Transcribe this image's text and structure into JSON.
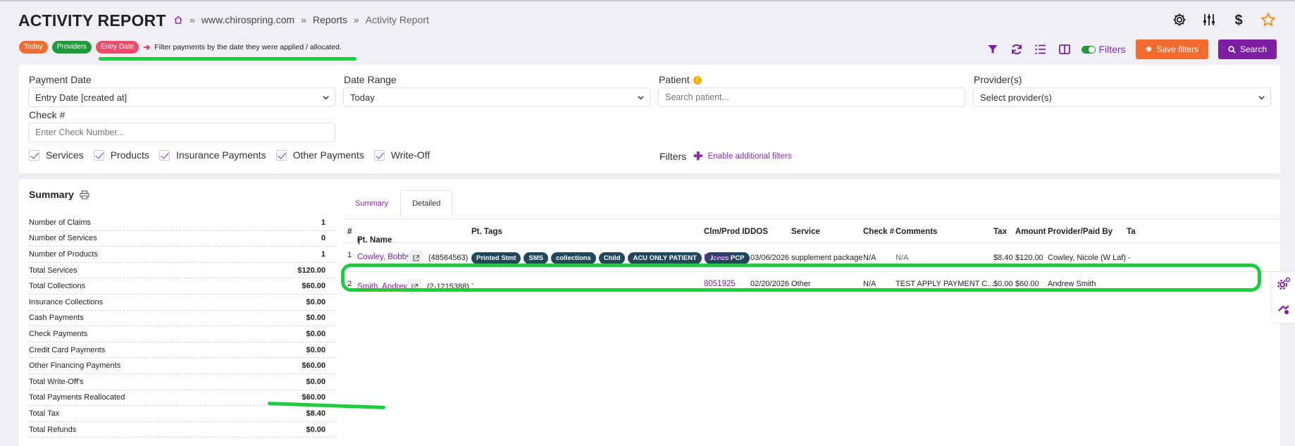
{
  "header": {
    "title": "ACTIVITY REPORT",
    "breadcrumb": [
      "www.chirospring.com",
      "Reports",
      "Activity Report"
    ],
    "separator": "»"
  },
  "badges": {
    "today": "Today",
    "providers": "Providers",
    "entry_date": "Entry Date",
    "description": "Filter payments by the date they were applied / allocated."
  },
  "toolbar": {
    "filters_label": "Filters",
    "save_filters": "Save filters",
    "search": "Search"
  },
  "filters": {
    "payment_date_label": "Payment Date",
    "payment_date_value": "Entry Date [created at]",
    "date_range_label": "Date Range",
    "date_range_value": "Today",
    "patient_label": "Patient",
    "patient_placeholder": "Search patient...",
    "providers_label": "Provider(s)",
    "providers_placeholder": "Select provider(s)",
    "check_label": "Check #",
    "check_placeholder": "Enter Check Number...",
    "checkboxes": [
      "Services",
      "Products",
      "Insurance Payments",
      "Other Payments",
      "Write-Off"
    ],
    "filters_label": "Filters",
    "enable_additional": "Enable additional filters"
  },
  "summary": {
    "title": "Summary",
    "rows": [
      {
        "label": "Number of Claims",
        "value": "1"
      },
      {
        "label": "Number of Services",
        "value": "0"
      },
      {
        "label": "Number of Products",
        "value": "1"
      },
      {
        "label": "Total Services",
        "value": "$120.00"
      },
      {
        "label": "Total Collections",
        "value": "$60.00"
      },
      {
        "label": "Insurance Collections",
        "value": "$0.00"
      },
      {
        "label": "Cash Payments",
        "value": "$0.00"
      },
      {
        "label": "Check Payments",
        "value": "$0.00"
      },
      {
        "label": "Credit Card Payments",
        "value": "$0.00"
      },
      {
        "label": "Other Financing Payments",
        "value": "$60.00"
      },
      {
        "label": "Total Write-Off's",
        "value": "$0.00"
      },
      {
        "label": "Total Payments Reallocated",
        "value": "$60.00"
      },
      {
        "label": "Total Tax",
        "value": "$8.40"
      },
      {
        "label": "Total Refunds",
        "value": "$0.00"
      }
    ]
  },
  "tabs": [
    "Summary",
    "Detailed"
  ],
  "table": {
    "headers": [
      "#",
      "Pt. Name",
      "Pt. Tags",
      "Clm/Prod ID",
      "DOS",
      "Service",
      "Check #",
      "Comments",
      "Tax",
      "Amount",
      "Provider/Paid By",
      "Ta"
    ],
    "rows": [
      {
        "num": "1",
        "name": "Cowley, Bobby",
        "pid": "(48564563)",
        "tags": [
          "Printed Stmt",
          "SMS",
          "collections",
          "Child",
          "ACU ONLY PATIENT",
          "Jones PCP"
        ],
        "claim": "574940",
        "dos": "03/06/2026",
        "service": "supplement package",
        "check": "N/A",
        "comments": "N/A",
        "tax": "$8.40",
        "amount": "$120.00",
        "provider": "Cowley, Nicole (W Laf)",
        "extra": "-"
      },
      {
        "num": "2",
        "name": "Smith, Andrew",
        "pid": "(2-1215388)",
        "tags_text": "-",
        "claim": "8051925",
        "dos": "02/20/2026",
        "service": "Other",
        "check": "N/A",
        "comments": "TEST APPLY PAYMENT C...",
        "tax": "$0.00",
        "amount": "$60.00",
        "provider": "Andrew Smith"
      }
    ]
  },
  "colors": {
    "accent": "#7c1fa3",
    "orange": "#f26b2f",
    "green": "#1f9a3b",
    "highlight": "#1ccd3f",
    "tag_bg": "#20475a"
  }
}
